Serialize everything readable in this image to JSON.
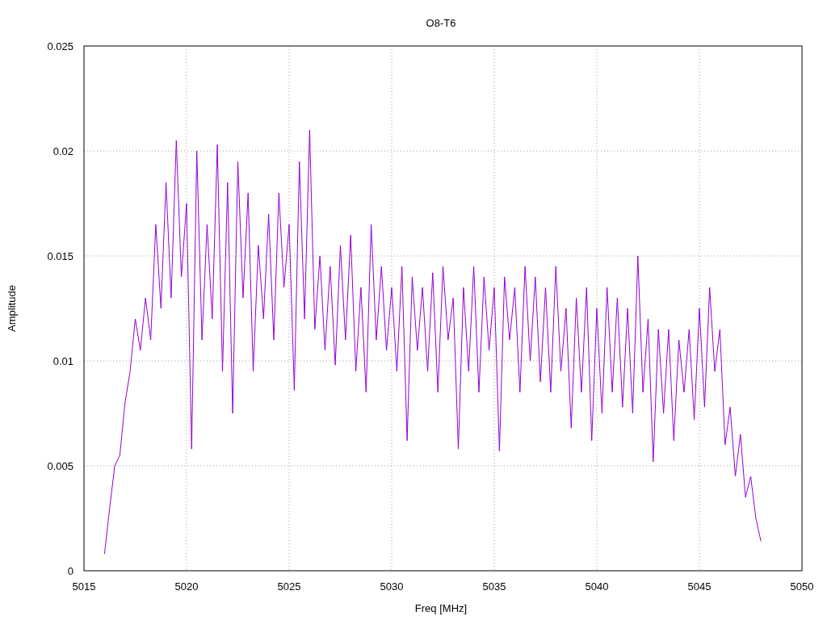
{
  "chart_data": {
    "type": "line",
    "grid": true,
    "title": "O8-T6",
    "xlabel": "Freq [MHz]",
    "ylabel": "Amplitude",
    "xlim": [
      5015,
      5050
    ],
    "ylim": [
      0,
      0.025
    ],
    "xticks": [
      {
        "value": 5015,
        "label": "5015"
      },
      {
        "value": 5020,
        "label": "5020"
      },
      {
        "value": 5025,
        "label": "5025"
      },
      {
        "value": 5030,
        "label": "5030"
      },
      {
        "value": 5035,
        "label": "5035"
      },
      {
        "value": 5040,
        "label": "5040"
      },
      {
        "value": 5045,
        "label": "5045"
      },
      {
        "value": 5050,
        "label": "5050"
      }
    ],
    "yticks": [
      {
        "value": 0,
        "label": "0"
      },
      {
        "value": 0.005,
        "label": "0.005"
      },
      {
        "value": 0.01,
        "label": "0.01"
      },
      {
        "value": 0.015,
        "label": "0.015"
      },
      {
        "value": 0.02,
        "label": "0.02"
      },
      {
        "value": 0.025,
        "label": "0.025"
      }
    ],
    "x": [
      5016,
      5016.25,
      5016.5,
      5016.75,
      5017,
      5017.25,
      5017.5,
      5017.75,
      5018,
      5018.25,
      5018.5,
      5018.75,
      5019,
      5019.25,
      5019.5,
      5019.75,
      5020,
      5020.25,
      5020.5,
      5020.75,
      5021,
      5021.25,
      5021.5,
      5021.75,
      5022,
      5022.25,
      5022.5,
      5022.75,
      5023,
      5023.25,
      5023.5,
      5023.75,
      5024,
      5024.25,
      5024.5,
      5024.75,
      5025,
      5025.25,
      5025.5,
      5025.75,
      5026,
      5026.25,
      5026.5,
      5026.75,
      5027,
      5027.25,
      5027.5,
      5027.75,
      5028,
      5028.25,
      5028.5,
      5028.75,
      5029,
      5029.25,
      5029.5,
      5029.75,
      5030,
      5030.25,
      5030.5,
      5030.75,
      5031,
      5031.25,
      5031.5,
      5031.75,
      5032,
      5032.25,
      5032.5,
      5032.75,
      5033,
      5033.25,
      5033.5,
      5033.75,
      5034,
      5034.25,
      5034.5,
      5034.75,
      5035,
      5035.25,
      5035.5,
      5035.75,
      5036,
      5036.25,
      5036.5,
      5036.75,
      5037,
      5037.25,
      5037.5,
      5037.75,
      5038,
      5038.25,
      5038.5,
      5038.75,
      5039,
      5039.25,
      5039.5,
      5039.75,
      5040,
      5040.25,
      5040.5,
      5040.75,
      5041,
      5041.25,
      5041.5,
      5041.75,
      5042,
      5042.25,
      5042.5,
      5042.75,
      5043,
      5043.25,
      5043.5,
      5043.75,
      5044,
      5044.25,
      5044.5,
      5044.75,
      5045,
      5045.25,
      5045.5,
      5045.75,
      5046,
      5046.25,
      5046.5,
      5046.75,
      5047,
      5047.25,
      5047.5,
      5047.75,
      5048
    ],
    "series": [
      {
        "color": "#9400d3",
        "values": [
          0.0008,
          0.003,
          0.005,
          0.0055,
          0.008,
          0.0095,
          0.012,
          0.0105,
          0.013,
          0.011,
          0.0165,
          0.0125,
          0.0185,
          0.013,
          0.0205,
          0.014,
          0.0175,
          0.0058,
          0.02,
          0.011,
          0.0165,
          0.012,
          0.0203,
          0.0095,
          0.0185,
          0.0075,
          0.0195,
          0.013,
          0.018,
          0.0095,
          0.0155,
          0.012,
          0.017,
          0.011,
          0.018,
          0.0135,
          0.0165,
          0.0086,
          0.0195,
          0.012,
          0.021,
          0.0115,
          0.015,
          0.0105,
          0.0145,
          0.0098,
          0.0155,
          0.011,
          0.016,
          0.0095,
          0.0135,
          0.0085,
          0.0165,
          0.011,
          0.0145,
          0.0105,
          0.0135,
          0.0095,
          0.0145,
          0.0062,
          0.014,
          0.0105,
          0.0135,
          0.0095,
          0.0142,
          0.0085,
          0.0145,
          0.011,
          0.013,
          0.0058,
          0.0135,
          0.0095,
          0.0145,
          0.0085,
          0.014,
          0.0105,
          0.0135,
          0.0057,
          0.014,
          0.011,
          0.0135,
          0.0085,
          0.0145,
          0.01,
          0.014,
          0.009,
          0.0135,
          0.0085,
          0.0145,
          0.0095,
          0.0125,
          0.0068,
          0.013,
          0.0085,
          0.0135,
          0.0062,
          0.0125,
          0.0075,
          0.0135,
          0.0085,
          0.013,
          0.0078,
          0.0125,
          0.0075,
          0.015,
          0.0085,
          0.012,
          0.0052,
          0.0115,
          0.0075,
          0.0115,
          0.0062,
          0.011,
          0.0085,
          0.0115,
          0.0072,
          0.0125,
          0.0078,
          0.0135,
          0.0095,
          0.0115,
          0.006,
          0.0078,
          0.0045,
          0.0065,
          0.0035,
          0.0045,
          0.0025,
          0.0014
        ]
      }
    ]
  }
}
